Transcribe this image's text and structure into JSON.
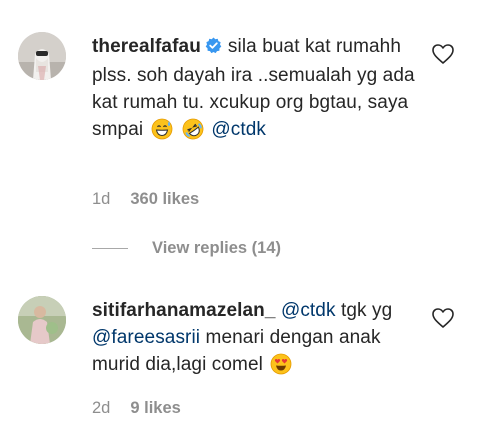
{
  "comments": [
    {
      "username": "therealfafau",
      "verified": true,
      "text_parts": [
        "sila buat kat rumahh plss. soh dayah ira ..semualah yg ada kat rumah tu. xcukup org bgtau, saya smpai",
        "@ctdk"
      ],
      "emojis": [
        "grinning-sweat-emoji",
        "rolling-laughing-emoji"
      ],
      "time": "1d",
      "likes": "360 likes",
      "replies": "View replies (14)"
    },
    {
      "username": "sitifarhanamazelan_",
      "verified": false,
      "text_parts": [
        "@ctdk",
        "tgk yg",
        "@fareesasrii",
        "menari dengan anak murid dia,lagi comel"
      ],
      "emojis": [
        "heart-eyes-emoji"
      ],
      "time": "2d",
      "likes": "9 likes"
    }
  ],
  "colors": {
    "text": "#262626",
    "mention": "#00376b",
    "meta": "#8e8e8e",
    "verified": "#3897f0"
  },
  "icons": {
    "like": "heart-outline-icon",
    "verified": "verified-badge-icon"
  }
}
